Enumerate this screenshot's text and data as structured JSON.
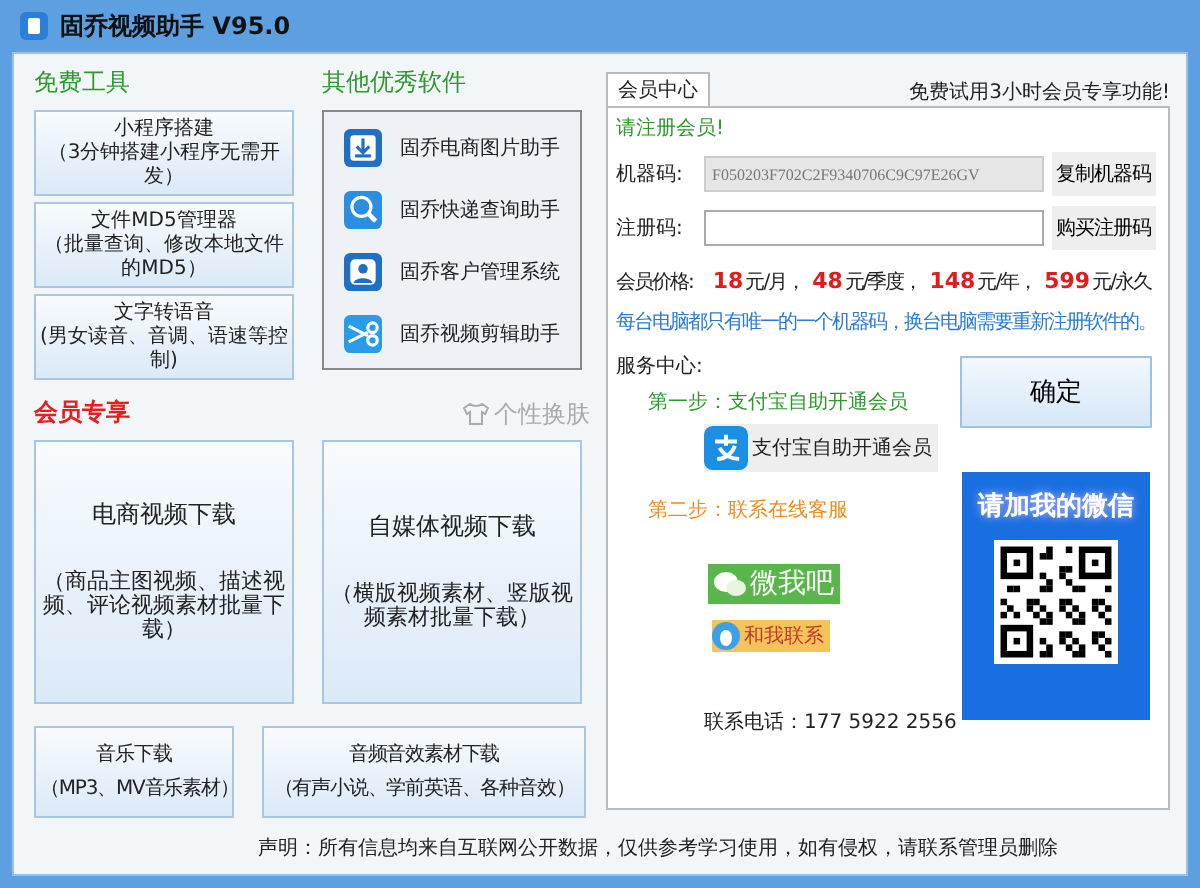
{
  "window": {
    "title": "固乔视频助手 V95.0"
  },
  "free_tools": {
    "heading": "免费工具",
    "buttons": [
      {
        "title": "小程序搭建",
        "subtitle": "（3分钟搭建小程序无需开发）"
      },
      {
        "title": "文件MD5管理器",
        "subtitle": "（批量查询、修改本地文件的MD5）"
      },
      {
        "title": "文字转语音",
        "subtitle": "(男女读音、音调、语速等控制)"
      }
    ]
  },
  "other_software": {
    "heading": "其他优秀软件",
    "items": [
      {
        "label": "固乔电商图片助手",
        "kind": "download"
      },
      {
        "label": "固乔快递查询助手",
        "kind": "search"
      },
      {
        "label": "固乔客户管理系统",
        "kind": "person"
      },
      {
        "label": "固乔视频剪辑助手",
        "kind": "scissors"
      }
    ]
  },
  "members_only": {
    "heading": "会员专享",
    "skin_link": "个性换肤",
    "buttons": [
      {
        "title": "电商视频下载",
        "subtitle": "（商品主图视频、描述视频、评论视频素材批量下载）",
        "kind": "large"
      },
      {
        "title": "自媒体视频下载",
        "subtitle": "（横版视频素材、竖版视频素材批量下载）",
        "kind": "large"
      },
      {
        "title": "音乐下载",
        "subtitle": "（MP3、MV音乐素材）",
        "kind": "small"
      },
      {
        "title": "音频音效素材下载",
        "subtitle": "（有声小说、学前英语、各种音效）",
        "kind": "small"
      }
    ]
  },
  "member_center": {
    "tab": {
      "label": "会员中心",
      "selected": true
    },
    "trial_note": "免费试用3小时会员专享功能!",
    "register_prompt": "请注册会员!",
    "machine_code": {
      "label": "机器码:",
      "value": "F050203F702C2F9340706C9C97E26GV",
      "button": "复制机器码"
    },
    "register_code": {
      "label": "注册码:",
      "button": "购买注册码"
    },
    "price": {
      "label": "会员价格:",
      "tiers": [
        {
          "amount": "18",
          "unit": "元/月，"
        },
        {
          "amount": "48",
          "unit": "元/季度，"
        },
        {
          "amount": "148",
          "unit": "元/年，"
        },
        {
          "amount": "599",
          "unit": "元/永久"
        }
      ]
    },
    "notice": "每台电脑都只有唯一的一个机器码，换台电脑需要重新注册软件的。",
    "service": {
      "heading": "服务中心:",
      "step1": "第一步：支付宝自助开通会员",
      "alipay_button": "支付宝自助开通会员",
      "step2": "第二步：联系在线客服",
      "wechat_button": "微我吧",
      "qq_button": "和我联系",
      "phone": "联系电话：177 5922 2556",
      "qr_title": "请加我的微信"
    },
    "confirm_button": "确定"
  },
  "footer": "声明：所有信息均来自互联网公开数据，仅供参考学习使用，如有侵权，请联系管理员删除"
}
